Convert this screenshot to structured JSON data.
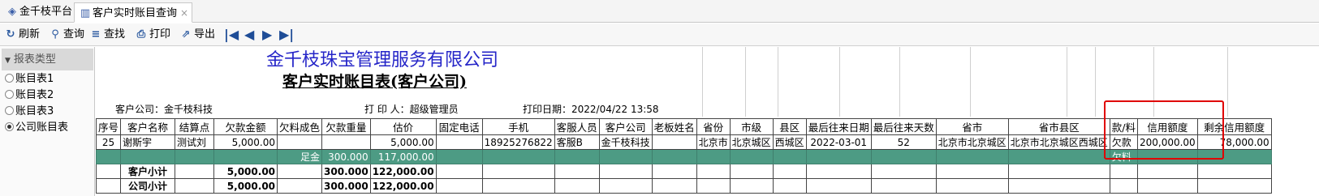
{
  "tabs": {
    "home_label": "金千枝平台",
    "active_label": "客户实时账目查询",
    "close": "×"
  },
  "toolbar": {
    "refresh": "刷新",
    "query": "查询",
    "find": "查找",
    "print": "打印",
    "export": "导出",
    "first": "|◀",
    "prev": "◀",
    "next": "▶",
    "last": "▶|"
  },
  "sidebar": {
    "header": "报表类型",
    "items": [
      {
        "label": "账目表1",
        "checked": false
      },
      {
        "label": "账目表2",
        "checked": false
      },
      {
        "label": "账目表3",
        "checked": false
      },
      {
        "label": "公司账目表",
        "checked": true
      }
    ]
  },
  "report": {
    "company": "金千枝珠宝管理服务有限公司",
    "title": "客户实时账目表(客户公司)",
    "customer_company": "客户公司：金千枝科技",
    "printer": "打 印 人：超级管理员",
    "print_date": "打印日期：2022/04/22 13:58",
    "columns": [
      "序号",
      "客户名称",
      "结算点",
      "欠款金额",
      "欠料成色",
      "欠款重量",
      "估价",
      "固定电话",
      "手机",
      "客服人员",
      "客户公司",
      "老板姓名",
      "省份",
      "市级",
      "县区",
      "最后往来日期",
      "最后往来天数",
      "省市",
      "省市县区",
      "款/料",
      "信用额度",
      "剩余信用额度"
    ],
    "rows": [
      [
        "25",
        "谢斯宇",
        "测试刘",
        "5,000.00",
        "",
        "",
        "5,000.00",
        "",
        "18925276822",
        "客服B",
        "金千枝科技",
        "",
        "北京市",
        "北京城区",
        "西城区",
        "2022-03-01",
        "52",
        "北京市北京城区",
        "北京市北京城区西城区",
        "欠款",
        "200,000.00",
        "78,000.00"
      ],
      [
        "",
        "",
        "",
        "",
        "足金",
        "300.000",
        "117,000.00",
        "",
        "",
        "",
        "",
        "",
        "",
        "",
        "",
        "",
        "",
        "",
        "",
        "欠料",
        "",
        ""
      ],
      [
        "",
        "客户小计",
        "",
        "5,000.00",
        "",
        "300.000",
        "122,000.00",
        "",
        "",
        "",
        "",
        "",
        "",
        "",
        "",
        "",
        "",
        "",
        "",
        "",
        "",
        ""
      ],
      [
        "",
        "公司小计",
        "",
        "5,000.00",
        "",
        "300.000",
        "122,000.00",
        "",
        "",
        "",
        "",
        "",
        "",
        "",
        "",
        "",
        "",
        "",
        "",
        "",
        "",
        ""
      ]
    ]
  },
  "colors": {
    "company": "#2525c8",
    "row_highlight": "#4d9b84",
    "annotation_box": "#e00000"
  }
}
